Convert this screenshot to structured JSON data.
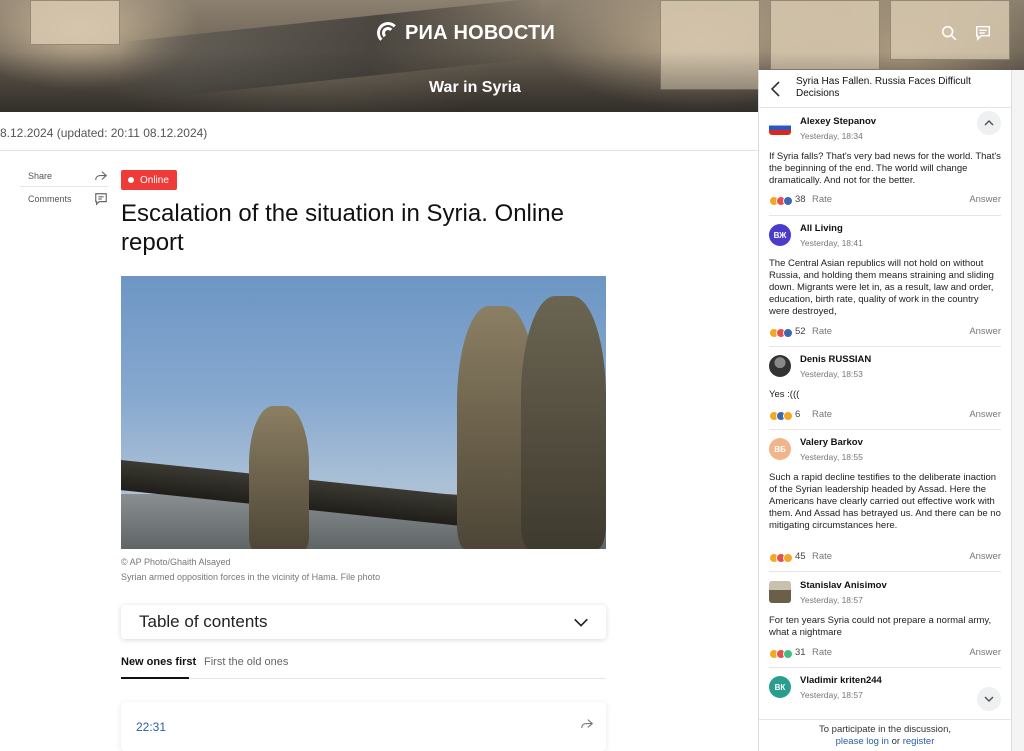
{
  "header": {
    "logo_text": "РИА НОВОСТИ",
    "section_title": "War in Syria",
    "icons": [
      "search-icon",
      "chat-icon"
    ]
  },
  "article": {
    "date_line": "8.12.2024  (updated: 20:11 08.12.2024)",
    "tools": {
      "share_label": "Share",
      "comments_label": "Comments"
    },
    "badge_label": "Online",
    "headline": "Escalation of the situation in Syria. Online report",
    "photo_credit": "© AP Photo/Ghaith Alsayed",
    "photo_caption": "Syrian armed opposition forces in the vicinity of Hama. File photo",
    "toc_label": "Table of contents",
    "sort_tabs": {
      "active": "New ones first",
      "inactive": "First the old ones"
    },
    "first_entry_time": "22:31"
  },
  "comments_panel": {
    "title": "Syria Has Fallen. Russia Faces Difficult Decisions",
    "rate_label": "Rate",
    "answer_label": "Answer",
    "comments": [
      {
        "author": "Alexey Stepanov",
        "time": "Yesterday, 18:34",
        "avatar_initials": "",
        "avatar_color": "#3b66b0",
        "text": "If Syria falls? That's very bad news for the world. That's the beginning of the end. The world will change dramatically. And not for the better.",
        "rating": "38"
      },
      {
        "author": "All Living",
        "time": "Yesterday, 18:41",
        "avatar_initials": "ВЖ",
        "avatar_color": "#4a3bc9",
        "text": "The Central Asian republics will not hold on without Russia, and holding them means straining and sliding down. Migrants were let in, as a result, law and order, education, birth rate, quality of work in the country were destroyed,",
        "rating": "52"
      },
      {
        "author": "Denis RUSSIAN",
        "time": "Yesterday, 18:53",
        "avatar_initials": "",
        "avatar_color": "#444444",
        "text": "Yes :(((",
        "rating": "6"
      },
      {
        "author": "Valery Barkov",
        "time": "Yesterday, 18:55",
        "avatar_initials": "ВБ",
        "avatar_color": "#f2b48a",
        "text": "Such a rapid decline testifies to the deliberate inaction of the Syrian leadership headed by Assad. Here the Americans have clearly carried out effective work with them. And Assad has betrayed us. And there can be no mitigating circumstances here.",
        "rating": "45"
      },
      {
        "author": "Stanislav Anisimov",
        "time": "Yesterday, 18:57",
        "avatar_initials": "",
        "avatar_color": "#6b5f4a",
        "text": "For ten years Syria could not prepare a normal army, what a nightmare",
        "rating": "31"
      },
      {
        "author": "Vladimir kriten244",
        "time": "Yesterday, 18:57",
        "avatar_initials": "ВК",
        "avatar_color": "#2a9d8f",
        "text": "",
        "rating": ""
      }
    ],
    "footer": {
      "prefix": "To participate in the discussion,",
      "login_link": "please log in",
      "or_text": "or",
      "register_link": "register"
    }
  }
}
